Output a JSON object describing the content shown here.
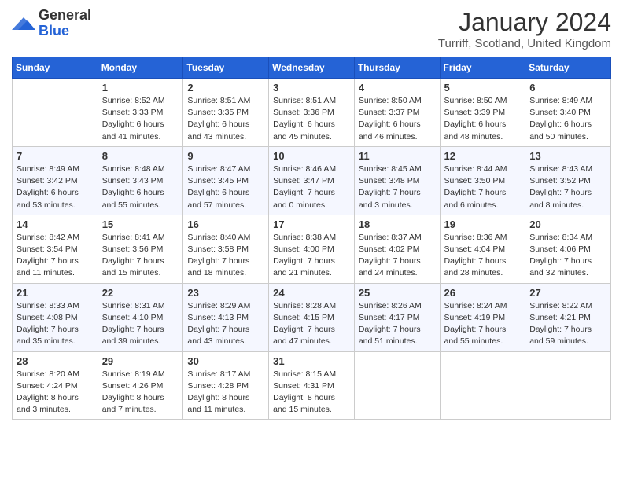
{
  "header": {
    "logo_general": "General",
    "logo_blue": "Blue",
    "month_title": "January 2024",
    "subtitle": "Turriff, Scotland, United Kingdom"
  },
  "weekdays": [
    "Sunday",
    "Monday",
    "Tuesday",
    "Wednesday",
    "Thursday",
    "Friday",
    "Saturday"
  ],
  "weeks": [
    [
      {
        "day": "",
        "sunrise": "",
        "sunset": "",
        "daylight": ""
      },
      {
        "day": "1",
        "sunrise": "Sunrise: 8:52 AM",
        "sunset": "Sunset: 3:33 PM",
        "daylight": "Daylight: 6 hours and 41 minutes."
      },
      {
        "day": "2",
        "sunrise": "Sunrise: 8:51 AM",
        "sunset": "Sunset: 3:35 PM",
        "daylight": "Daylight: 6 hours and 43 minutes."
      },
      {
        "day": "3",
        "sunrise": "Sunrise: 8:51 AM",
        "sunset": "Sunset: 3:36 PM",
        "daylight": "Daylight: 6 hours and 45 minutes."
      },
      {
        "day": "4",
        "sunrise": "Sunrise: 8:50 AM",
        "sunset": "Sunset: 3:37 PM",
        "daylight": "Daylight: 6 hours and 46 minutes."
      },
      {
        "day": "5",
        "sunrise": "Sunrise: 8:50 AM",
        "sunset": "Sunset: 3:39 PM",
        "daylight": "Daylight: 6 hours and 48 minutes."
      },
      {
        "day": "6",
        "sunrise": "Sunrise: 8:49 AM",
        "sunset": "Sunset: 3:40 PM",
        "daylight": "Daylight: 6 hours and 50 minutes."
      }
    ],
    [
      {
        "day": "7",
        "sunrise": "Sunrise: 8:49 AM",
        "sunset": "Sunset: 3:42 PM",
        "daylight": "Daylight: 6 hours and 53 minutes."
      },
      {
        "day": "8",
        "sunrise": "Sunrise: 8:48 AM",
        "sunset": "Sunset: 3:43 PM",
        "daylight": "Daylight: 6 hours and 55 minutes."
      },
      {
        "day": "9",
        "sunrise": "Sunrise: 8:47 AM",
        "sunset": "Sunset: 3:45 PM",
        "daylight": "Daylight: 6 hours and 57 minutes."
      },
      {
        "day": "10",
        "sunrise": "Sunrise: 8:46 AM",
        "sunset": "Sunset: 3:47 PM",
        "daylight": "Daylight: 7 hours and 0 minutes."
      },
      {
        "day": "11",
        "sunrise": "Sunrise: 8:45 AM",
        "sunset": "Sunset: 3:48 PM",
        "daylight": "Daylight: 7 hours and 3 minutes."
      },
      {
        "day": "12",
        "sunrise": "Sunrise: 8:44 AM",
        "sunset": "Sunset: 3:50 PM",
        "daylight": "Daylight: 7 hours and 6 minutes."
      },
      {
        "day": "13",
        "sunrise": "Sunrise: 8:43 AM",
        "sunset": "Sunset: 3:52 PM",
        "daylight": "Daylight: 7 hours and 8 minutes."
      }
    ],
    [
      {
        "day": "14",
        "sunrise": "Sunrise: 8:42 AM",
        "sunset": "Sunset: 3:54 PM",
        "daylight": "Daylight: 7 hours and 11 minutes."
      },
      {
        "day": "15",
        "sunrise": "Sunrise: 8:41 AM",
        "sunset": "Sunset: 3:56 PM",
        "daylight": "Daylight: 7 hours and 15 minutes."
      },
      {
        "day": "16",
        "sunrise": "Sunrise: 8:40 AM",
        "sunset": "Sunset: 3:58 PM",
        "daylight": "Daylight: 7 hours and 18 minutes."
      },
      {
        "day": "17",
        "sunrise": "Sunrise: 8:38 AM",
        "sunset": "Sunset: 4:00 PM",
        "daylight": "Daylight: 7 hours and 21 minutes."
      },
      {
        "day": "18",
        "sunrise": "Sunrise: 8:37 AM",
        "sunset": "Sunset: 4:02 PM",
        "daylight": "Daylight: 7 hours and 24 minutes."
      },
      {
        "day": "19",
        "sunrise": "Sunrise: 8:36 AM",
        "sunset": "Sunset: 4:04 PM",
        "daylight": "Daylight: 7 hours and 28 minutes."
      },
      {
        "day": "20",
        "sunrise": "Sunrise: 8:34 AM",
        "sunset": "Sunset: 4:06 PM",
        "daylight": "Daylight: 7 hours and 32 minutes."
      }
    ],
    [
      {
        "day": "21",
        "sunrise": "Sunrise: 8:33 AM",
        "sunset": "Sunset: 4:08 PM",
        "daylight": "Daylight: 7 hours and 35 minutes."
      },
      {
        "day": "22",
        "sunrise": "Sunrise: 8:31 AM",
        "sunset": "Sunset: 4:10 PM",
        "daylight": "Daylight: 7 hours and 39 minutes."
      },
      {
        "day": "23",
        "sunrise": "Sunrise: 8:29 AM",
        "sunset": "Sunset: 4:13 PM",
        "daylight": "Daylight: 7 hours and 43 minutes."
      },
      {
        "day": "24",
        "sunrise": "Sunrise: 8:28 AM",
        "sunset": "Sunset: 4:15 PM",
        "daylight": "Daylight: 7 hours and 47 minutes."
      },
      {
        "day": "25",
        "sunrise": "Sunrise: 8:26 AM",
        "sunset": "Sunset: 4:17 PM",
        "daylight": "Daylight: 7 hours and 51 minutes."
      },
      {
        "day": "26",
        "sunrise": "Sunrise: 8:24 AM",
        "sunset": "Sunset: 4:19 PM",
        "daylight": "Daylight: 7 hours and 55 minutes."
      },
      {
        "day": "27",
        "sunrise": "Sunrise: 8:22 AM",
        "sunset": "Sunset: 4:21 PM",
        "daylight": "Daylight: 7 hours and 59 minutes."
      }
    ],
    [
      {
        "day": "28",
        "sunrise": "Sunrise: 8:20 AM",
        "sunset": "Sunset: 4:24 PM",
        "daylight": "Daylight: 8 hours and 3 minutes."
      },
      {
        "day": "29",
        "sunrise": "Sunrise: 8:19 AM",
        "sunset": "Sunset: 4:26 PM",
        "daylight": "Daylight: 8 hours and 7 minutes."
      },
      {
        "day": "30",
        "sunrise": "Sunrise: 8:17 AM",
        "sunset": "Sunset: 4:28 PM",
        "daylight": "Daylight: 8 hours and 11 minutes."
      },
      {
        "day": "31",
        "sunrise": "Sunrise: 8:15 AM",
        "sunset": "Sunset: 4:31 PM",
        "daylight": "Daylight: 8 hours and 15 minutes."
      },
      {
        "day": "",
        "sunrise": "",
        "sunset": "",
        "daylight": ""
      },
      {
        "day": "",
        "sunrise": "",
        "sunset": "",
        "daylight": ""
      },
      {
        "day": "",
        "sunrise": "",
        "sunset": "",
        "daylight": ""
      }
    ]
  ]
}
